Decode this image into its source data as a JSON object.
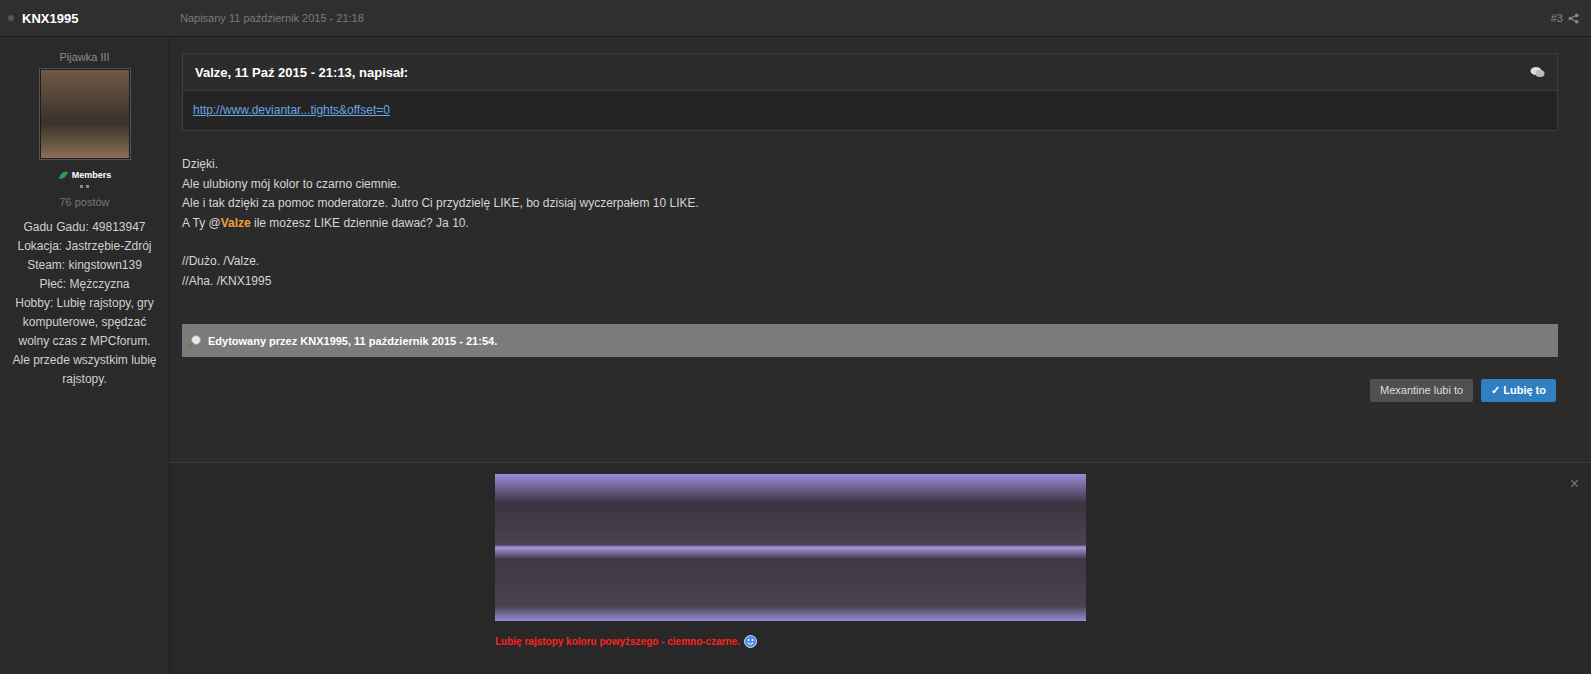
{
  "post": {
    "author": "KNX1995",
    "date": "Napisany 11 październik 2015 - 21:18",
    "number": "#3"
  },
  "author_panel": {
    "rank": "Pijawka III",
    "group": "Members",
    "post_count": "76 postów",
    "fields": [
      "Gadu Gadu: 49813947",
      "Lokacja: Jastrzębie-Zdrój",
      "Steam: kingstown139",
      "Płeć: Mężczyzna",
      "Hobby: Lubię rajstopy, gry komputerowe, spędzać wolny czas z MPCforum. Ale przede wszystkim lubię rajstopy."
    ]
  },
  "quote": {
    "header": "Valze, 11 Paź 2015 - 21:13, napisał:",
    "link": "http://www.deviantar...tights&offset=0"
  },
  "body": [
    [
      [
        {
          "text": "Dzięki.",
          "kind": "plain"
        }
      ],
      [
        {
          "text": "Ale ulubiony mój kolor to czarno ciemnie.",
          "kind": "plain"
        }
      ],
      [
        {
          "text": "Ale i tak dzięki za pomoc moderatorze. Jutro Ci przydzielę LIKE, bo dzisiaj wyczerpałem 10 LIKE.",
          "kind": "plain"
        }
      ],
      [
        {
          "text": "A Ty @",
          "kind": "plain"
        },
        {
          "text": "Valze",
          "kind": "mention"
        },
        {
          "text": " ile możesz LIKE dziennie dawać? Ja 10.",
          "kind": "plain"
        }
      ]
    ],
    [
      [
        {
          "text": "//Dużo. /Valze.",
          "kind": "plain"
        }
      ],
      [
        {
          "text": "//Aha. /KNX1995",
          "kind": "plain"
        }
      ]
    ]
  ],
  "edit_note": "Edytowany przez KNX1995, 11 październik 2015 - 21:54.",
  "likes": {
    "liked_by": "Mexantine lubi to",
    "button": {
      "icon": "✓",
      "label": "Lubię to",
      "selected": true
    }
  },
  "signature": {
    "caption": "Lubię rajstopy koloru powyższego - ciemno-czarne.",
    "close": "×"
  }
}
